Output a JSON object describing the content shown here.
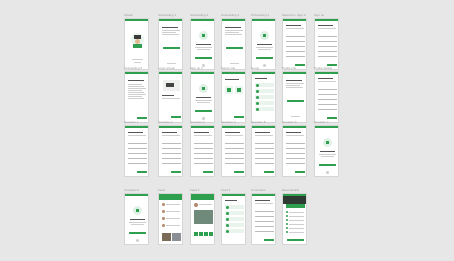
{
  "canvas": {
    "background": "#e7e7e7",
    "accent": "#2e9e4f"
  },
  "frames": [
    {
      "label": "Splash",
      "kind": "splash"
    },
    {
      "label": "Onboarding 1",
      "kind": "text-btn"
    },
    {
      "label": "Onboarding 2",
      "kind": "icon-btn"
    },
    {
      "label": "Onboarding 3",
      "kind": "text-btn"
    },
    {
      "label": "Onboarding 4",
      "kind": "icon-btn"
    },
    {
      "label": "Welcome / Sign in",
      "kind": "form"
    },
    {
      "label": "Sign up",
      "kind": "form"
    },
    {
      "label": "Onboarding 5",
      "kind": "text"
    },
    {
      "label": "Login screen",
      "kind": "image-card"
    },
    {
      "label": "Sign up 2",
      "kind": "icon-btn"
    },
    {
      "label": "Select role",
      "kind": "cards"
    },
    {
      "label": "Home",
      "kind": "list"
    },
    {
      "label": "Profile info",
      "kind": "text-btn"
    },
    {
      "label": "Profile details",
      "kind": "form"
    },
    {
      "label": "Question 1",
      "kind": "form"
    },
    {
      "label": "Question 2",
      "kind": "form"
    },
    {
      "label": "Question 3",
      "kind": "form"
    },
    {
      "label": "Question 4",
      "kind": "form"
    },
    {
      "label": "Question 5",
      "kind": "form"
    },
    {
      "label": "Question 6",
      "kind": "form"
    },
    {
      "label": "Question 7",
      "kind": "icon-btn"
    },
    {
      "label": "Completed",
      "kind": "icon-btn"
    },
    {
      "label": "Feed",
      "kind": "feed"
    },
    {
      "label": "Feed 2",
      "kind": "feed2"
    },
    {
      "label": "Feed 3",
      "kind": "list"
    },
    {
      "label": "Comments",
      "kind": "form"
    },
    {
      "label": "Event details",
      "kind": "event"
    }
  ]
}
